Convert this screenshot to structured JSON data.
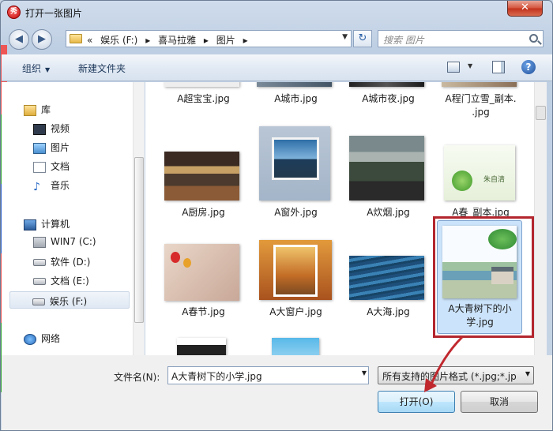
{
  "window": {
    "title": "打开一张图片",
    "close_glyph": "✕",
    "app_icon_glyph": "秀"
  },
  "address": {
    "crumbs": [
      "«",
      "娱乐 (F:)",
      "▸",
      "喜马拉雅",
      "▸",
      "图片",
      "▸"
    ],
    "search_placeholder": "搜索 图片"
  },
  "toolbar": {
    "organize": "组织",
    "new_folder": "新建文件夹",
    "help": "?"
  },
  "sidebar": {
    "items": [
      {
        "label": "库",
        "icon": "library-icon"
      },
      {
        "label": "视频",
        "icon": "video-icon"
      },
      {
        "label": "图片",
        "icon": "pictures-icon"
      },
      {
        "label": "文档",
        "icon": "documents-icon"
      },
      {
        "label": "音乐",
        "icon": "music-icon"
      },
      {
        "label": "计算机",
        "icon": "computer-icon"
      },
      {
        "label": "WIN7 (C:)",
        "icon": "drive-icon"
      },
      {
        "label": "软件 (D:)",
        "icon": "drive-icon"
      },
      {
        "label": "文档 (E:)",
        "icon": "drive-icon"
      },
      {
        "label": "娱乐 (F:)",
        "icon": "drive-icon"
      },
      {
        "label": "网络",
        "icon": "network-icon"
      }
    ]
  },
  "files": [
    {
      "name": "A超宝宝.jpg"
    },
    {
      "name": "A城市.jpg"
    },
    {
      "name": "A城市夜.jpg"
    },
    {
      "name": "A程门立雪_副本.",
      "name2": ".jpg"
    },
    {
      "name": "A厨房.jpg"
    },
    {
      "name": "A窗外.jpg"
    },
    {
      "name": "A炊烟.jpg"
    },
    {
      "name": "A春_副本.jpg",
      "thumb_text": "朱自清"
    },
    {
      "name": "A春节.jpg"
    },
    {
      "name": "A大窗户.jpg"
    },
    {
      "name": "A大海.jpg"
    },
    {
      "name": "A大青树下的小",
      "name2": "学.jpg"
    }
  ],
  "bottom": {
    "filename_label": "文件名(N):",
    "filename_value": "A大青树下的小学.jpg",
    "filetype_value": "所有支持的图片格式 (*.jpg;*.jp",
    "open_button": "打开(O)",
    "cancel_button": "取消"
  },
  "colors": {
    "selection": "#cce4fb",
    "highlight_box": "#b3262e",
    "arrow": "#c0282e"
  }
}
